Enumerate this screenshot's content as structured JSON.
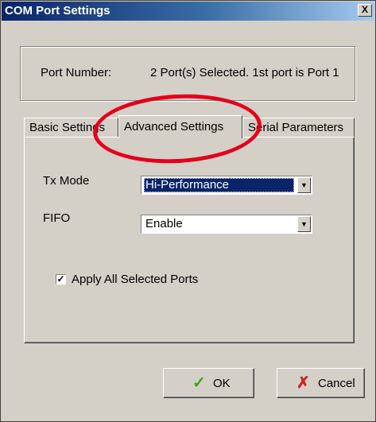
{
  "window": {
    "title": "COM Port Settings",
    "close_label": "X"
  },
  "port": {
    "label": "Port Number:",
    "value": "2 Port(s) Selected. 1st port is Port 1"
  },
  "tabs": [
    {
      "label": "Basic Settings",
      "active": false
    },
    {
      "label": "Advanced Settings",
      "active": true
    },
    {
      "label": "Serial Parameters",
      "active": false
    }
  ],
  "fields": {
    "tx_mode": {
      "label": "Tx Mode",
      "value": "Hi-Performance"
    },
    "fifo": {
      "label": "FIFO",
      "value": "Enable"
    }
  },
  "apply_all": {
    "label": "Apply All Selected Ports",
    "checked": true
  },
  "buttons": {
    "ok": {
      "label": "OK",
      "icon": "checkmark-icon"
    },
    "cancel": {
      "label": "Cancel",
      "icon": "x-icon"
    }
  },
  "annotation": {
    "color": "#e4001b",
    "target": "Advanced Settings tab"
  }
}
